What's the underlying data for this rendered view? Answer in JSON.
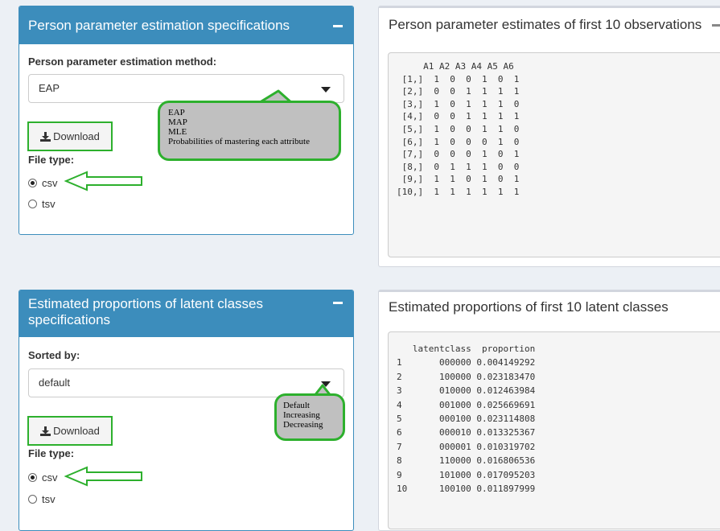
{
  "panel1": {
    "title": "Person parameter estimation specifications",
    "method_label": "Person parameter estimation method:",
    "method_value": "EAP",
    "download": "Download",
    "filetype_label": "File type:",
    "options": [
      "csv",
      "tsv"
    ],
    "selected": "csv"
  },
  "panel1_callout": [
    "EAP",
    "MAP",
    "MLE",
    "Probabilities of mastering each attribute"
  ],
  "panel2": {
    "title": "Person parameter estimates of first 10 observations",
    "output": "     A1 A2 A3 A4 A5 A6\n [1,]  1  0  0  1  0  1\n [2,]  0  0  1  1  1  1\n [3,]  1  0  1  1  1  0\n [4,]  0  0  1  1  1  1\n [5,]  1  0  0  1  1  0\n [6,]  1  0  0  0  1  0\n [7,]  0  0  0  1  0  1\n [8,]  0  1  1  1  0  0\n [9,]  1  1  0  1  0  1\n[10,]  1  1  1  1  1  1"
  },
  "panel3": {
    "title": "Estimated proportions of latent classes specifications",
    "sort_label": "Sorted by:",
    "sort_value": "default",
    "download": "Download",
    "filetype_label": "File type:",
    "options": [
      "csv",
      "tsv"
    ],
    "selected": "csv"
  },
  "panel3_callout": [
    "Default",
    "Increasing",
    "Decreasing"
  ],
  "panel4": {
    "title": "Estimated proportions of first 10 latent classes",
    "output": "   latentclass  proportion\n1       000000 0.004149292\n2       100000 0.023183470\n3       010000 0.012463984\n4       001000 0.025669691\n5       000100 0.023114808\n6       000010 0.013325367\n7       000001 0.010319702\n8       110000 0.016806536\n9       101000 0.017095203\n10      100100 0.011897999"
  },
  "colors": {
    "header_blue": "#3c8dbc",
    "annotation_green": "#2db02d",
    "callout_gray": "#c0c0c0"
  }
}
